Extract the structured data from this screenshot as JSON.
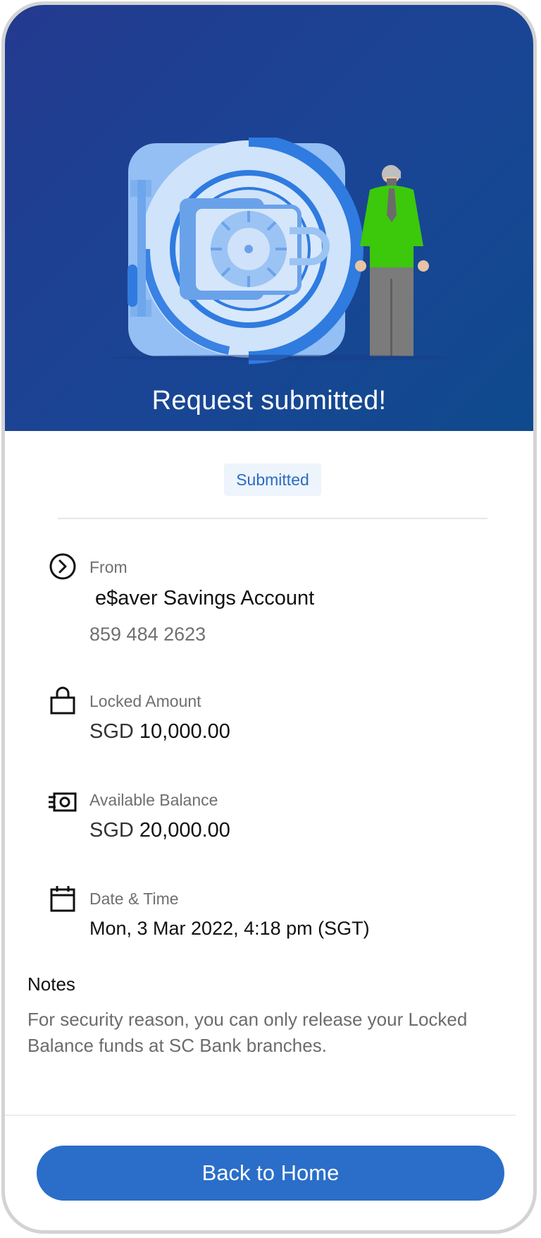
{
  "header": {
    "title": "Request submitted!"
  },
  "status": {
    "badge": "Submitted"
  },
  "details": {
    "from": {
      "label": "From",
      "account_name": "e$aver Savings Account",
      "account_number": "859 484 2623",
      "icon": "chevron-right-circle-icon"
    },
    "locked": {
      "label": "Locked Amount",
      "currency": "SGD",
      "amount": "10,000.00",
      "icon": "lock-icon"
    },
    "available": {
      "label": "Available Balance",
      "currency": "SGD",
      "amount": "20,000.00",
      "icon": "money-icon"
    },
    "datetime": {
      "label": "Date & Time",
      "value": "Mon, 3 Mar 2022,  4:18 pm  (SGT)",
      "icon": "calendar-icon"
    }
  },
  "notes": {
    "title": "Notes",
    "text": "For security reason, you can only release your Locked Balance funds at  SC Bank branches."
  },
  "footer": {
    "button_label": "Back to Home"
  },
  "colors": {
    "hero": "#1f4190",
    "accent": "#2a6ec9",
    "badge_bg": "#eef4fb",
    "figure_shirt": "#3cc80b"
  }
}
